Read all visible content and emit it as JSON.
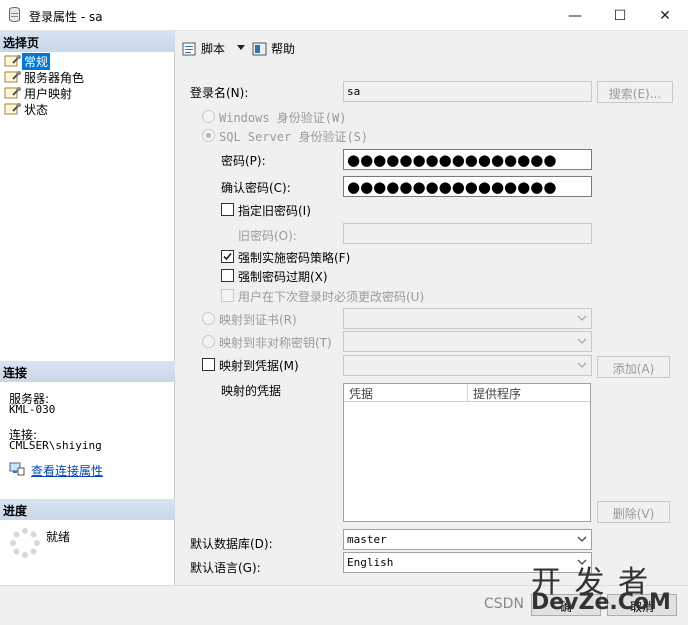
{
  "window": {
    "title": "登录属性 - sa",
    "minimize": "—",
    "maximize": "☐",
    "close": "✕"
  },
  "left": {
    "select_page_header": "选择页",
    "pages": [
      {
        "label": "常规",
        "active": true
      },
      {
        "label": "服务器角色",
        "active": false
      },
      {
        "label": "用户映射",
        "active": false
      },
      {
        "label": "状态",
        "active": false
      }
    ],
    "connection_header": "连接",
    "server_label": "服务器:",
    "server_value": "KML-030",
    "connection_label": "连接:",
    "connection_value": "CMLSER\\shiying",
    "view_conn_props": "查看连接属性",
    "progress_header": "进度",
    "progress_status": "就绪"
  },
  "toolbar": {
    "script_label": "脚本",
    "help_label": "帮助"
  },
  "form": {
    "login_name_label": "登录名(N):",
    "login_name_value": "sa",
    "search_button": "搜索(E)...",
    "windows_auth_label": "Windows 身份验证(W)",
    "sql_auth_label": "SQL Server 身份验证(S)",
    "password_label": "密码(P):",
    "password_value": "●●●●●●●●●●●●●●●●",
    "confirm_password_label": "确认密码(C):",
    "confirm_password_value": "●●●●●●●●●●●●●●●●",
    "specify_old_password_label": "指定旧密码(I)",
    "old_password_label": "旧密码(O):",
    "old_password_value": "",
    "enforce_policy_label": "强制实施密码策略(F)",
    "enforce_expiration_label": "强制密码过期(X)",
    "must_change_label": "用户在下次登录时必须更改密码(U)",
    "map_cert_label": "映射到证书(R)",
    "map_asym_key_label": "映射到非对称密钥(T)",
    "map_credential_label": "映射到凭据(M)",
    "add_button": "添加(A)",
    "mapped_credentials_label": "映射的凭据",
    "grid_col_credential": "凭据",
    "grid_col_provider": "提供程序",
    "remove_button": "删除(V)",
    "default_db_label": "默认数据库(D):",
    "default_db_value": "master",
    "default_lang_label": "默认语言(G):",
    "default_lang_value": "English"
  },
  "state": {
    "windows_auth_selected": false,
    "sql_auth_selected": true,
    "specify_old_password": false,
    "enforce_policy": true,
    "enforce_expiration": false,
    "must_change": false,
    "map_credential": false
  },
  "watermark": {
    "csdn_text": "CSDN",
    "big_text": "开 发 者",
    "domain_text": "DevZe.CoM",
    "ok_partial": "确",
    "cancel_partial": "取消"
  },
  "colors": {
    "accent": "#0078d7",
    "header_bg": "#c8d7ea",
    "link": "#0645ad"
  }
}
